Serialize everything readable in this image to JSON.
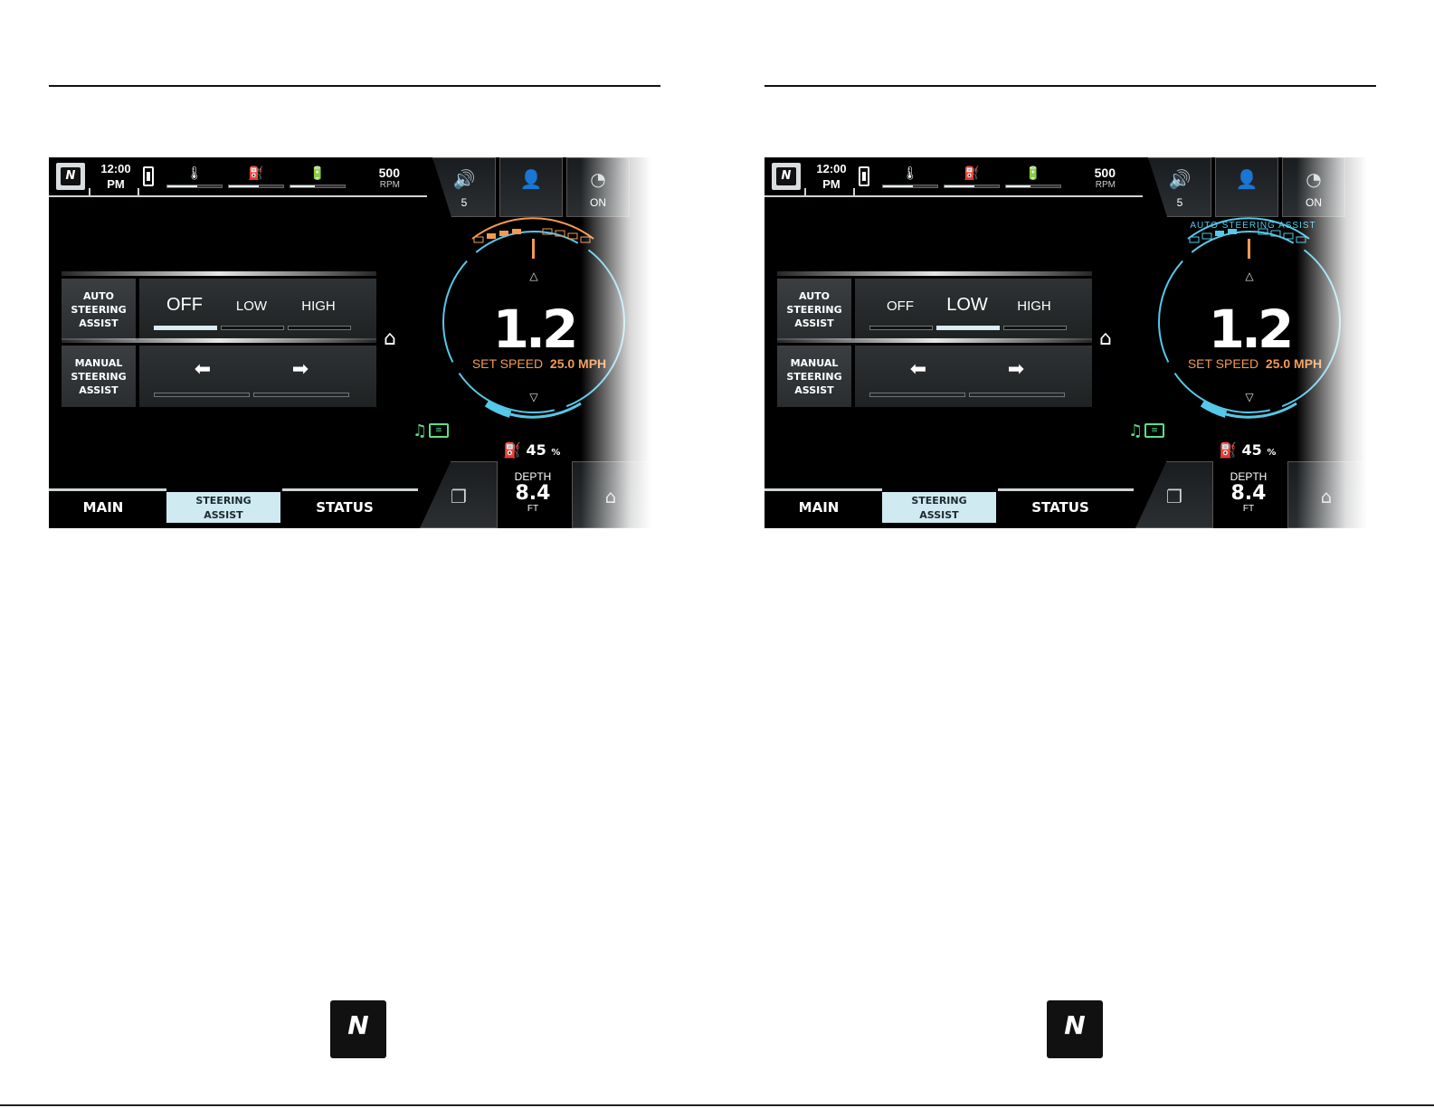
{
  "screens": [
    {
      "clock": {
        "time": "12:00",
        "ampm": "PM"
      },
      "gauges": {
        "temp_level": 0.55,
        "oil_level": 0.55,
        "battery_level": 0.45
      },
      "rpm": {
        "value": "500",
        "unit": "RPM"
      },
      "quick": {
        "volume_value": "5",
        "cruise_value": "ON"
      },
      "auto_assist": {
        "label_line1": "AUTO",
        "label_line2": "STEERING",
        "label_line3": "ASSIST",
        "options": [
          "OFF",
          "LOW",
          "HIGH"
        ],
        "selected": "OFF"
      },
      "manual_assist": {
        "label_line1": "MANUAL",
        "label_line2": "STEERING",
        "label_line3": "ASSIST"
      },
      "speed": {
        "value": "1.2",
        "set_label": "SET SPEED",
        "set_value": "25.0 MPH",
        "arc_label": ""
      },
      "fuel": {
        "value": "45",
        "unit": "%"
      },
      "depth": {
        "label": "DEPTH",
        "value": "8.4",
        "unit": "FT"
      },
      "tabs": {
        "main": "MAIN",
        "steering_line1": "STEERING",
        "steering_line2": "ASSIST",
        "status": "STATUS"
      }
    },
    {
      "clock": {
        "time": "12:00",
        "ampm": "PM"
      },
      "gauges": {
        "temp_level": 0.55,
        "oil_level": 0.55,
        "battery_level": 0.45
      },
      "rpm": {
        "value": "500",
        "unit": "RPM"
      },
      "quick": {
        "volume_value": "5",
        "cruise_value": "ON"
      },
      "auto_assist": {
        "label_line1": "AUTO",
        "label_line2": "STEERING",
        "label_line3": "ASSIST",
        "options": [
          "OFF",
          "LOW",
          "HIGH"
        ],
        "selected": "LOW"
      },
      "manual_assist": {
        "label_line1": "MANUAL",
        "label_line2": "STEERING",
        "label_line3": "ASSIST"
      },
      "speed": {
        "value": "1.2",
        "set_label": "SET SPEED",
        "set_value": "25.0 MPH",
        "arc_label": "AUTO STEERING ASSIST"
      },
      "fuel": {
        "value": "45",
        "unit": "%"
      },
      "depth": {
        "label": "DEPTH",
        "value": "8.4",
        "unit": "FT"
      },
      "tabs": {
        "main": "MAIN",
        "steering_line1": "STEERING",
        "steering_line2": "ASSIST",
        "status": "STATUS"
      }
    }
  ],
  "colors": {
    "accent_orange": "#f39a52",
    "accent_cyan": "#56c8e8",
    "active_tab": "#cfeaf1",
    "music_green": "#59e08a"
  },
  "icons": [
    "nautique-logo-icon",
    "phone-icon",
    "temperature-icon",
    "oil-icon",
    "battery-icon",
    "volume-icon",
    "profile-icon",
    "cruise-gauge-icon",
    "home-icon",
    "music-icon",
    "equalizer-icon",
    "fuel-icon",
    "screens-icon",
    "hull-left-icon",
    "hull-right-icon"
  ]
}
